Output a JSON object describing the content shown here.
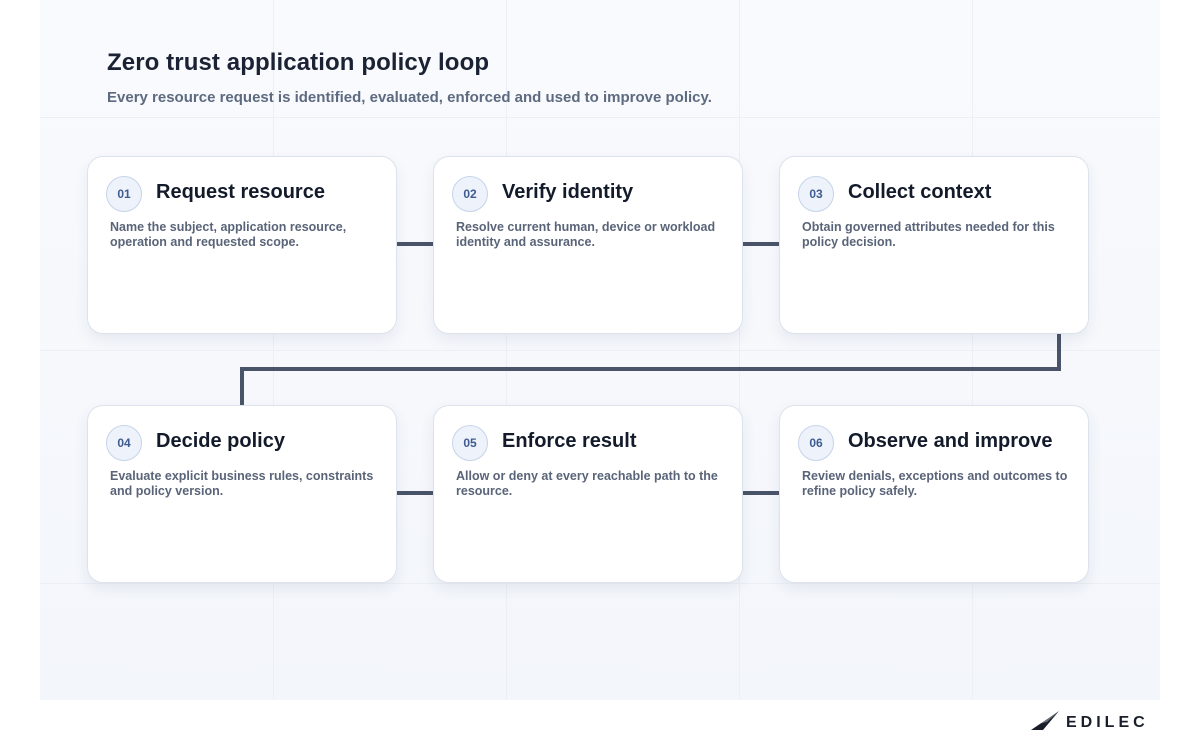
{
  "header": {
    "title": "Zero trust application policy loop",
    "subtitle": "Every resource request is identified, evaluated, enforced and used to improve policy."
  },
  "steps": [
    {
      "number": "01",
      "title": "Request resource",
      "description": "Name the subject, application resource, operation and requested scope."
    },
    {
      "number": "02",
      "title": "Verify identity",
      "description": "Resolve current human, device or workload identity and assurance."
    },
    {
      "number": "03",
      "title": "Collect context",
      "description": "Obtain governed attributes needed for this policy decision."
    },
    {
      "number": "04",
      "title": "Decide policy",
      "description": "Evaluate explicit business rules, constraints and policy version."
    },
    {
      "number": "05",
      "title": "Enforce result",
      "description": "Allow or deny at every reachable path to the resource."
    },
    {
      "number": "06",
      "title": "Observe and improve",
      "description": "Review denials, exceptions and outcomes to refine policy safely."
    }
  ],
  "brand": {
    "logo_text": "EDILEC",
    "logo_icon": "paper-plane-icon"
  },
  "colors": {
    "connector": "#4a5468",
    "badge_text": "#3f5b8f",
    "title": "#1a2233"
  }
}
